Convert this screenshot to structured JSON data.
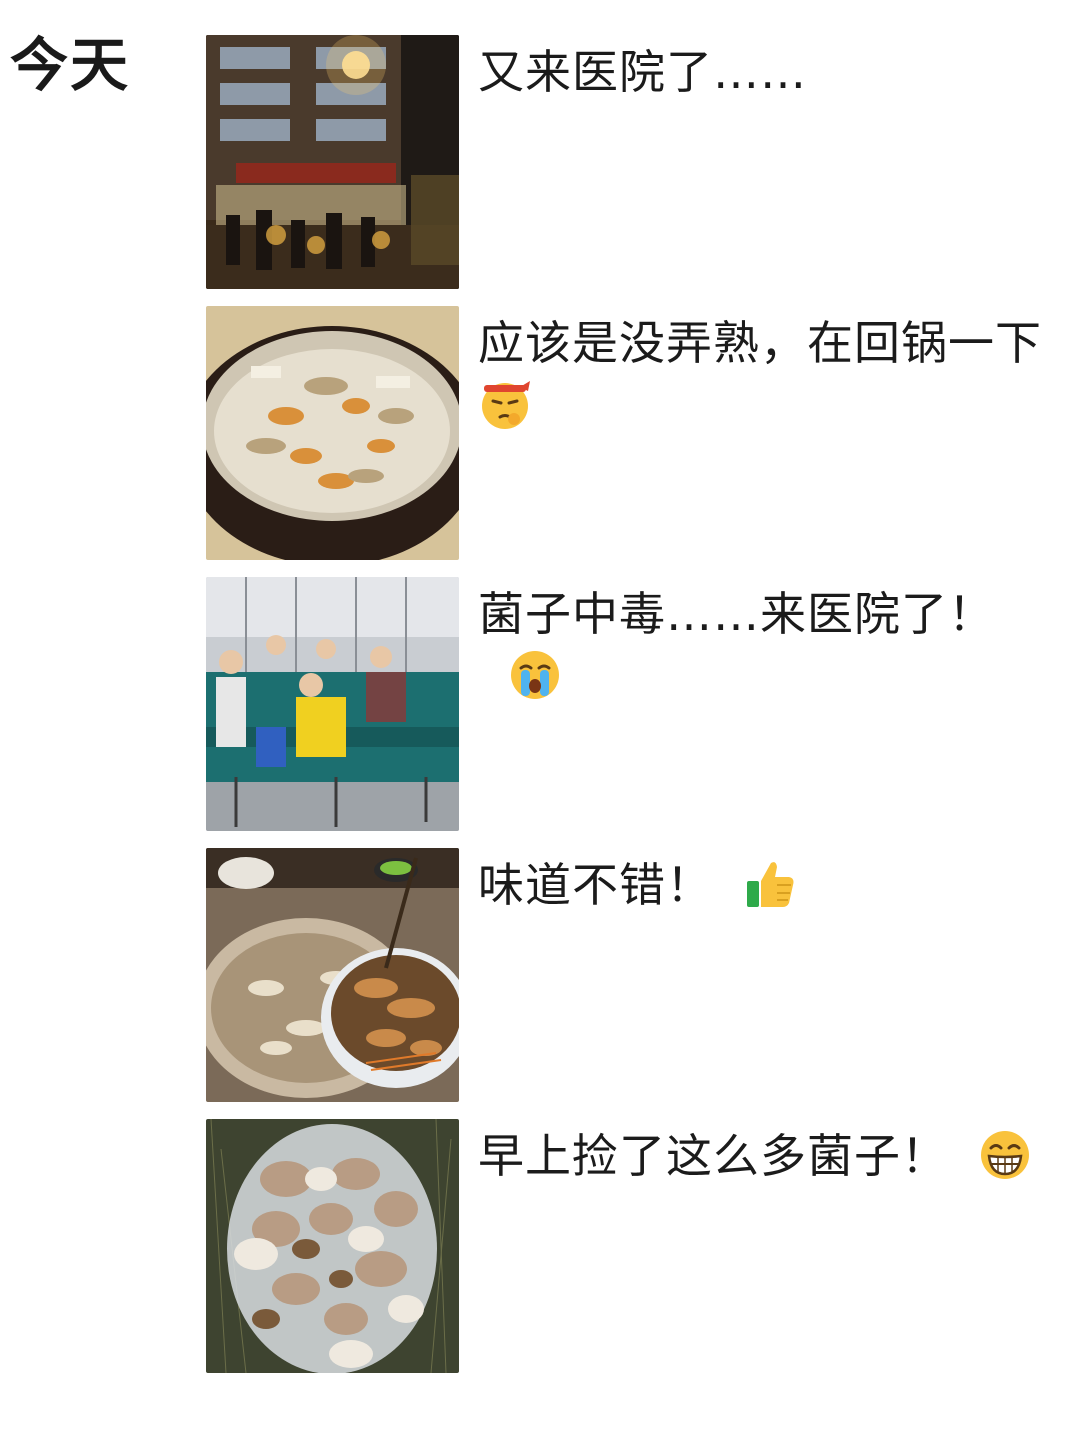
{
  "day_label": "今天",
  "posts": [
    {
      "image": "hospital-night-exterior-photo",
      "caption": "又来医院了……",
      "emoji": null
    },
    {
      "image": "mushroom-hotpot-photo",
      "caption": "应该是没弄熟，在回锅一下",
      "emoji": "pondering-headband-emoji"
    },
    {
      "image": "hospital-infusion-room-photo",
      "caption": "菌子中毒……来医院了！",
      "emoji": "crying-emoji"
    },
    {
      "image": "mushroom-dish-plate-photo",
      "caption": "味道不错！",
      "emoji": "thumbs-up-emoji"
    },
    {
      "image": "picked-mushrooms-bag-photo",
      "caption": "早上捡了这么多菌子！",
      "emoji": "grinning-emoji"
    }
  ],
  "colors": {
    "text": "#1b1b1b",
    "background": "#ffffff",
    "emoji_yellow": "#f9c23c"
  }
}
